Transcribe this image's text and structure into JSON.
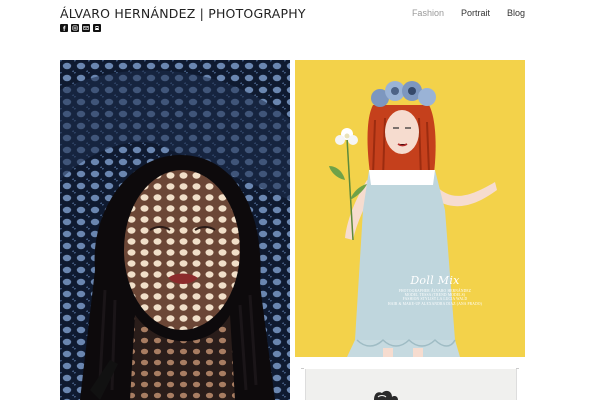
{
  "header": {
    "site_title": "ÁLVARO HERNÁNDEZ | PHOTOGRAPHY",
    "social_icons": [
      "facebook-icon",
      "instagram-icon",
      "email-icon",
      "phone-icon"
    ]
  },
  "nav": {
    "items": [
      {
        "label": "Fashion",
        "active": true
      },
      {
        "label": "Portrait",
        "active": false
      },
      {
        "label": "Blog",
        "active": false
      }
    ],
    "active_color": "#999999",
    "default_color": "#333333"
  },
  "gallery": {
    "photo2": {
      "caption_title": "Doll Mix",
      "credits": [
        "PHOTOGRAPHER ÁLVARO HERNÁNDEZ",
        "MODEL TESSA (TREND MODELS)",
        "FASHION STYLIST LA LUCIA WALD",
        "HAIR & MAKE-UP ALEXANDRA DIAZ (ANA PRADO)"
      ],
      "background_color": "#f3d24a"
    }
  }
}
